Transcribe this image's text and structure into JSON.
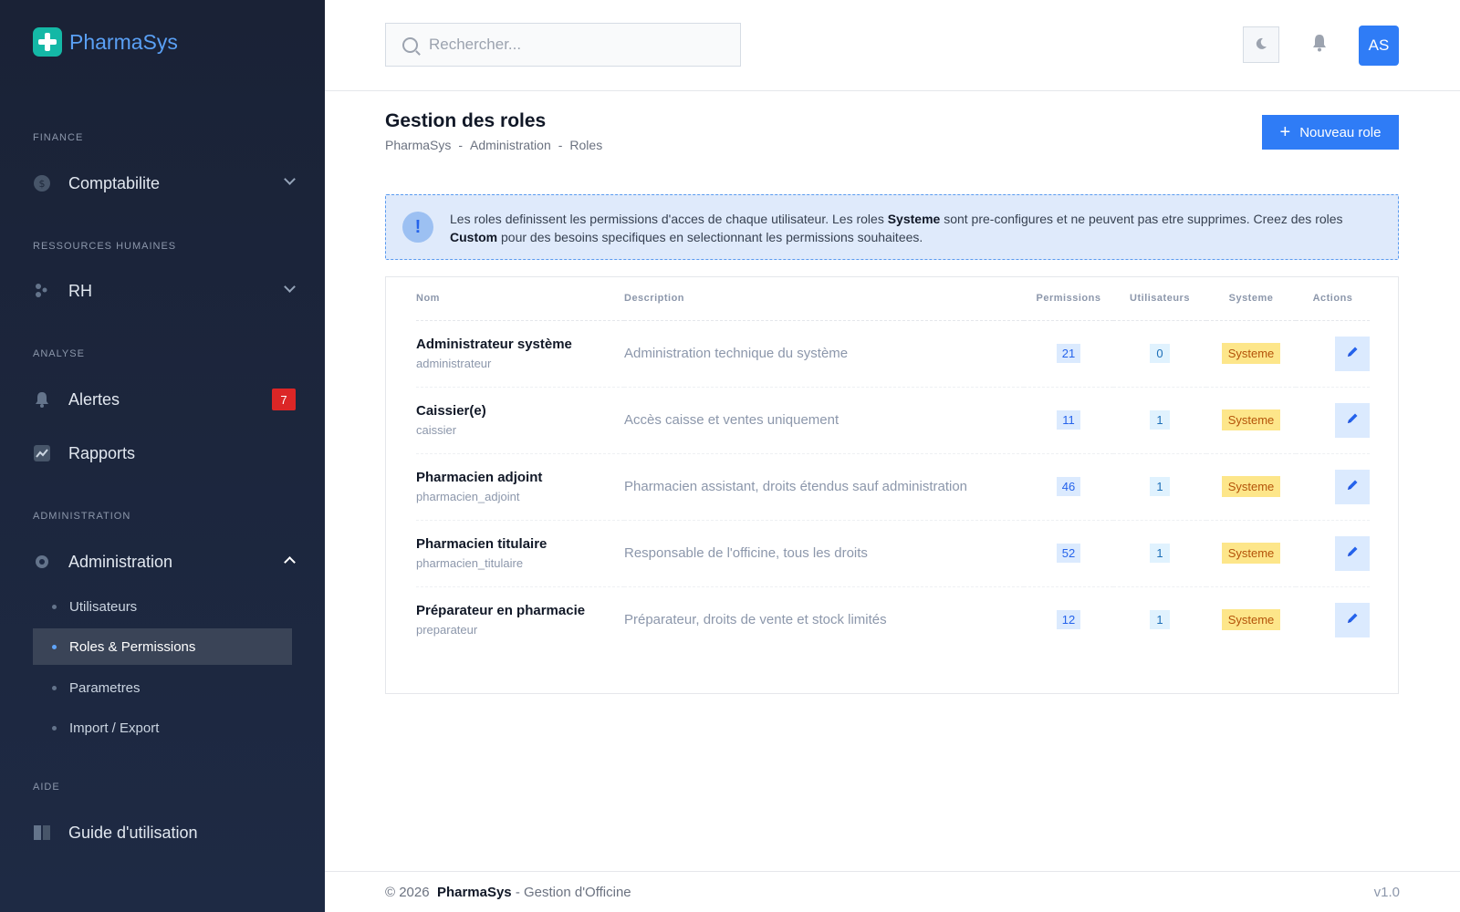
{
  "app": {
    "name": "PharmaSys"
  },
  "sidebar": {
    "sections": {
      "finance": "FINANCE",
      "rh": "RESSOURCES HUMAINES",
      "analyse": "ANALYSE",
      "administration": "ADMINISTRATION",
      "aide": "AIDE"
    },
    "items": {
      "comptabilite": "Comptabilite",
      "rh": "RH",
      "alertes": "Alertes",
      "alertes_badge": "7",
      "rapports": "Rapports",
      "administration": "Administration",
      "guide": "Guide d'utilisation"
    },
    "admin_sub": {
      "utilisateurs": "Utilisateurs",
      "roles": "Roles & Permissions",
      "parametres": "Parametres",
      "import_export": "Import / Export"
    }
  },
  "header": {
    "search_placeholder": "Rechercher...",
    "avatar": "AS"
  },
  "page": {
    "title": "Gestion des roles",
    "breadcrumb": [
      "PharmaSys",
      "Administration",
      "Roles"
    ],
    "new_button": "Nouveau role"
  },
  "info": {
    "part1": "Les roles definissent les permissions d'acces de chaque utilisateur. Les roles ",
    "bold1": "Systeme",
    "part2": " sont pre-configures et ne peuvent pas etre supprimes. Creez des roles ",
    "bold2": "Custom",
    "part3": " pour des besoins specifiques en selectionnant les permissions souhaitees."
  },
  "table": {
    "headers": {
      "nom": "Nom",
      "description": "Description",
      "permissions": "Permissions",
      "utilisateurs": "Utilisateurs",
      "systeme": "Systeme",
      "actions": "Actions"
    },
    "rows": [
      {
        "name": "Administrateur système",
        "key": "administrateur",
        "desc": "Administration technique du système",
        "perms": "21",
        "users": "0",
        "type": "Systeme"
      },
      {
        "name": "Caissier(e)",
        "key": "caissier",
        "desc": "Accès caisse et ventes uniquement",
        "perms": "11",
        "users": "1",
        "type": "Systeme"
      },
      {
        "name": "Pharmacien adjoint",
        "key": "pharmacien_adjoint",
        "desc": "Pharmacien assistant, droits étendus sauf administration",
        "perms": "46",
        "users": "1",
        "type": "Systeme"
      },
      {
        "name": "Pharmacien titulaire",
        "key": "pharmacien_titulaire",
        "desc": "Responsable de l'officine, tous les droits",
        "perms": "52",
        "users": "1",
        "type": "Systeme"
      },
      {
        "name": "Préparateur en pharmacie",
        "key": "preparateur",
        "desc": "Préparateur, droits de vente et stock limités",
        "perms": "12",
        "users": "1",
        "type": "Systeme"
      }
    ]
  },
  "footer": {
    "copy": "© 2026",
    "brand": "PharmaSys",
    "suffix": "- Gestion d'Officine",
    "version": "v1.0"
  }
}
